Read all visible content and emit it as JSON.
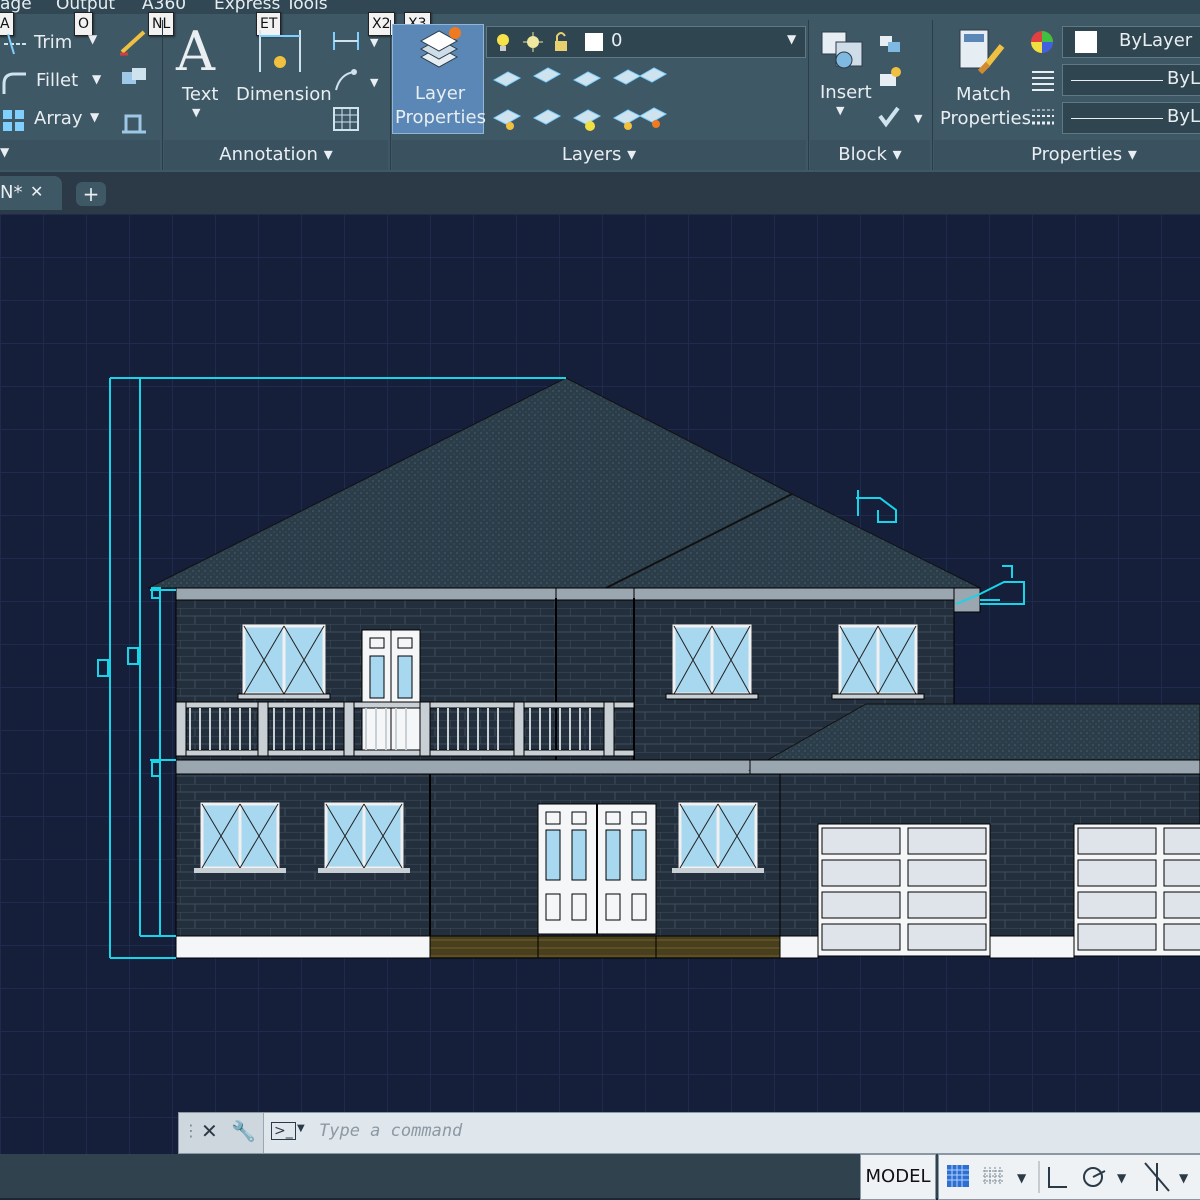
{
  "ribbon_tabs": {
    "manage": "age",
    "output": "Output",
    "a360": "A360",
    "express": "Express Tools"
  },
  "keytips": [
    "A",
    "O",
    "NL",
    "ET",
    "X2",
    "X3"
  ],
  "modify": {
    "trim": "Trim",
    "fillet": "Fillet",
    "array": "Array"
  },
  "annotation": {
    "text": "Text",
    "dimension": "Dimension",
    "panel_title": "Annotation"
  },
  "layers": {
    "layer_properties_line1": "Layer",
    "layer_properties_line2": "Properties",
    "current_layer": "0",
    "panel_title": "Layers"
  },
  "block": {
    "insert": "Insert",
    "panel_title": "Block"
  },
  "properties": {
    "match_line1": "Match",
    "match_line2": "Properties",
    "color": "ByLayer",
    "linetype": "ByLa",
    "lineweight": "ByLa",
    "panel_title": "Properties"
  },
  "document": {
    "tab_label": "N*"
  },
  "command": {
    "placeholder": "Type a command"
  },
  "status": {
    "model": "MODEL"
  },
  "colors": {
    "ribbon": "#3f5865",
    "canvas": "#151f3a",
    "dimension": "#18d4e8",
    "brick": "#242f3d",
    "roof": "#2c3d4a",
    "window": "#a8d8f0"
  },
  "icons": [
    "pencil-icon",
    "layer-stack-icon",
    "insert-block-icon",
    "match-brush-icon",
    "color-wheel-icon",
    "grid-icon",
    "snap-icon",
    "ortho-icon",
    "polar-icon"
  ]
}
